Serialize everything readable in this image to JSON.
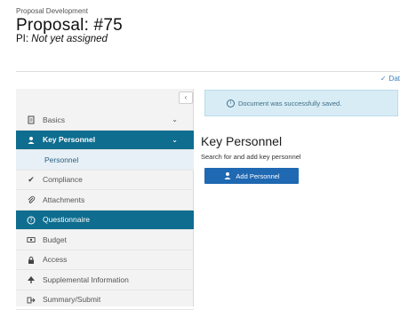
{
  "header": {
    "module": "Proposal Development",
    "title": "Proposal: #75",
    "pi_label": "PI:",
    "pi_value": "Not yet assigned"
  },
  "top_link": {
    "label": "Dat"
  },
  "sidebar": {
    "collapse_label": "‹",
    "items": [
      {
        "label": "Basics"
      },
      {
        "label": "Key Personnel"
      },
      {
        "label": "Personnel"
      },
      {
        "label": "Compliance"
      },
      {
        "label": "Attachments"
      },
      {
        "label": "Questionnaire"
      },
      {
        "label": "Budget"
      },
      {
        "label": "Access"
      },
      {
        "label": "Supplemental Information"
      },
      {
        "label": "Summary/Submit"
      }
    ]
  },
  "alert": {
    "message": "Document was successfully saved."
  },
  "main": {
    "section_title": "Key Personnel",
    "section_subtitle": "Search for and add key personnel",
    "add_button_label": "Add Personnel"
  }
}
